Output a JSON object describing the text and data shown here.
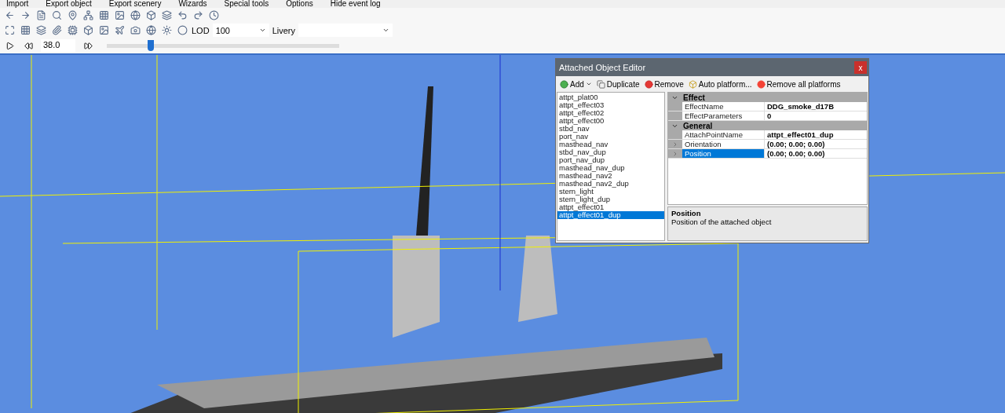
{
  "menu": [
    "Import",
    "Export object",
    "Export scenery",
    "Wizards",
    "Special tools",
    "Options",
    "Hide event log"
  ],
  "toolbar": {
    "lod_label": "LOD",
    "lod_value": "100",
    "livery_label": "Livery"
  },
  "timeline": {
    "time": "38.0",
    "level": 0.19
  },
  "editor": {
    "title": "Attached Object Editor",
    "close": "x",
    "actions": [
      {
        "label": "Add",
        "kind": "add"
      },
      {
        "label": "Duplicate",
        "kind": "duplicate"
      },
      {
        "label": "Remove",
        "kind": "remove"
      },
      {
        "label": "Auto platform...",
        "kind": "auto"
      },
      {
        "label": "Remove all platforms",
        "kind": "removeall"
      }
    ],
    "items": [
      {
        "label": "attpt_plat00",
        "selected": false
      },
      {
        "label": "attpt_effect03",
        "selected": false
      },
      {
        "label": "attpt_effect02",
        "selected": false
      },
      {
        "label": "attpt_effect00",
        "selected": false
      },
      {
        "label": "stbd_nav",
        "selected": false
      },
      {
        "label": "port_nav",
        "selected": false
      },
      {
        "label": "masthead_nav",
        "selected": false
      },
      {
        "label": "stbd_nav_dup",
        "selected": false
      },
      {
        "label": "port_nav_dup",
        "selected": false
      },
      {
        "label": "masthead_nav_dup",
        "selected": false
      },
      {
        "label": "masthead_nav2",
        "selected": false
      },
      {
        "label": "masthead_nav2_dup",
        "selected": false
      },
      {
        "label": "stern_light",
        "selected": false
      },
      {
        "label": "stern_light_dup",
        "selected": false
      },
      {
        "label": "attpt_effect01",
        "selected": false
      },
      {
        "label": "attpt_effect01_dup",
        "selected": true
      }
    ],
    "categories": [
      {
        "name": "Effect",
        "expanded": true,
        "rows": [
          {
            "name": "EffectName",
            "value": "DDG_smoke_d17B",
            "expandable": false,
            "selected": false
          },
          {
            "name": "EffectParameters",
            "value": "0",
            "expandable": false,
            "selected": false
          }
        ]
      },
      {
        "name": "General",
        "expanded": true,
        "rows": [
          {
            "name": "AttachPointName",
            "value": "attpt_effect01_dup",
            "expandable": false,
            "selected": false
          },
          {
            "name": "Orientation",
            "value": "(0.00; 0.00; 0.00)",
            "expandable": true,
            "selected": false
          },
          {
            "name": "Position",
            "value": "(0.00; 0.00; 0.00)",
            "expandable": true,
            "selected": true
          }
        ]
      }
    ],
    "description": {
      "title": "Position",
      "text": "Position of the attached object"
    }
  }
}
